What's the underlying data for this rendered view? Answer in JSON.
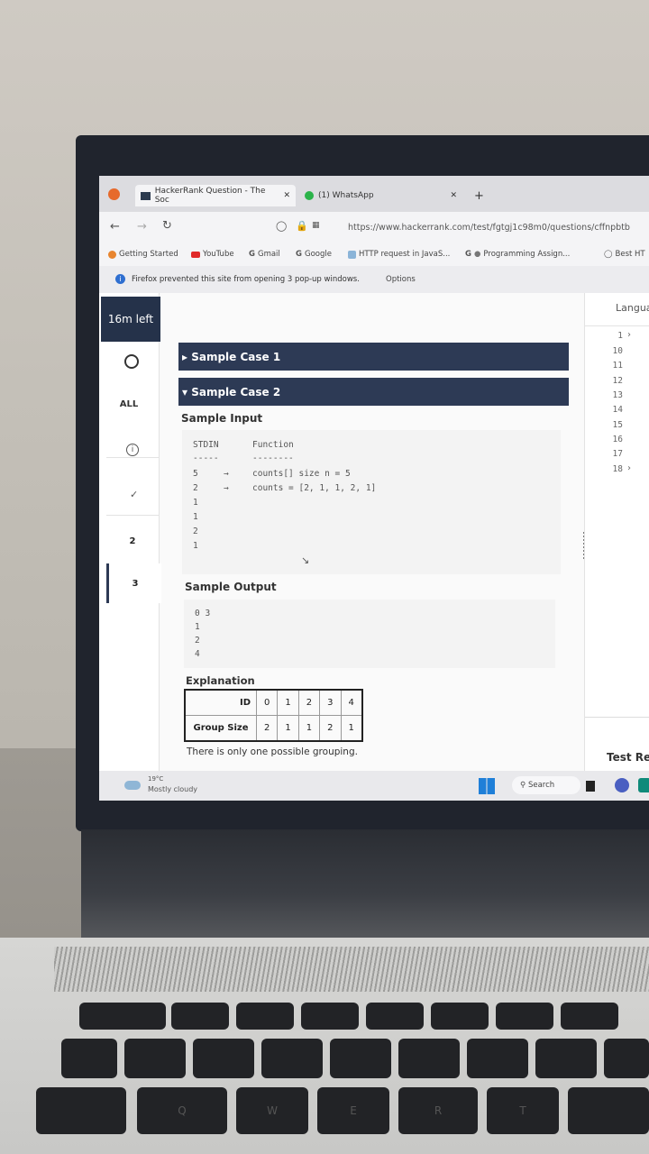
{
  "browser": {
    "tabs": [
      {
        "label": "HackerRank Question - The Soc",
        "close": "✕"
      },
      {
        "label": "(1) WhatsApp",
        "close": "✕"
      }
    ],
    "new_tab": "+",
    "url": "https://www.hackerrank.com/test/fgtgj1c98m0/questions/cffnpbtb",
    "bookmarks": [
      "Getting Started",
      "YouTube",
      "Gmail",
      "Google",
      "HTTP request in JavaS...",
      "Programming Assign...",
      "Best HT"
    ],
    "notice": "Firefox prevented this site from opening 3 pop-up windows.",
    "notice_button": "Options"
  },
  "sidebar": {
    "timer": "16m left",
    "all_label": "ALL",
    "questions": [
      "2",
      "3"
    ]
  },
  "problem": {
    "case1": "▸ Sample Case 1",
    "case2": "▾ Sample Case 2",
    "sample_input_title": "Sample Input",
    "stdin_header": "STDIN",
    "function_header": "Function",
    "stdin_dashes": "-----",
    "function_dashes": "--------",
    "input_lines": [
      {
        "value": "5",
        "arrow": "→",
        "func": "counts[] size n = 5"
      },
      {
        "value": "2",
        "arrow": "→",
        "func": "counts = [2, 1, 1, 2, 1]"
      },
      {
        "value": "1",
        "arrow": "",
        "func": ""
      },
      {
        "value": "1",
        "arrow": "",
        "func": ""
      },
      {
        "value": "2",
        "arrow": "",
        "func": ""
      },
      {
        "value": "1",
        "arrow": "",
        "func": ""
      }
    ],
    "sample_output_title": "Sample Output",
    "output_lines": [
      "0 3",
      "1",
      "2",
      "4"
    ],
    "explanation_title": "Explanation",
    "table": {
      "row1_header": "ID",
      "row1": [
        "0",
        "1",
        "2",
        "3",
        "4"
      ],
      "row2_header": "Group Size",
      "row2": [
        "2",
        "1",
        "1",
        "2",
        "1"
      ]
    },
    "explanation_text": "There is only one possible grouping."
  },
  "editor": {
    "language_label": "Langua",
    "line_numbers": [
      "1",
      "10",
      "11",
      "12",
      "13",
      "14",
      "15",
      "16",
      "17",
      "18"
    ],
    "test_results_label": "Test Re"
  },
  "taskbar": {
    "weather_temp": "19°C",
    "weather_desc": "Mostly cloudy",
    "search_label": "Search"
  },
  "keyboard": {
    "keys": [
      "Q",
      "W",
      "E",
      "R",
      "T"
    ]
  }
}
